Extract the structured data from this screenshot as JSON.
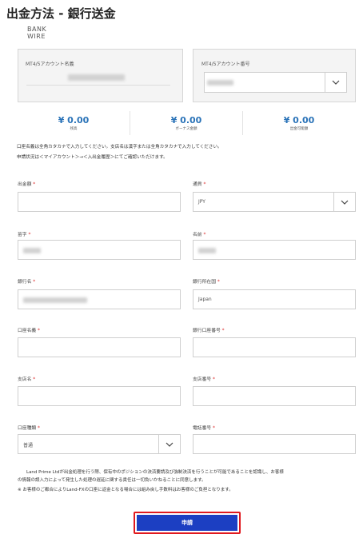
{
  "page_title": "出金方法 - 銀行送金",
  "logo": {
    "line1": "BANK",
    "line2": "WIRE"
  },
  "account": {
    "name_label": "MT4/5アカウント名義",
    "number_label": "MT4/5アカウント番号"
  },
  "balances": [
    {
      "value": "¥ 0.00",
      "label": "残高"
    },
    {
      "value": "¥ 0.00",
      "label": "ボーナス金額"
    },
    {
      "value": "¥ 0.00",
      "label": "出金可能額"
    }
  ],
  "notes": {
    "line1": "口座名義は全角カタカナで入力してください。支店名は漢字または全角カタカナで入力してください。",
    "line2": "申請状況は＜マイアカウント＞→＜入出金履歴＞にてご確認いただけます。"
  },
  "required_mark": "*",
  "form": {
    "amount_label": "出金額",
    "currency_label": "通貨",
    "currency_value": "JPY",
    "last_name_label": "苗字",
    "first_name_label": "名前",
    "bank_name_label": "銀行名",
    "bank_country_label": "銀行所在国",
    "bank_country_value": "Japan",
    "account_holder_label": "口座名義",
    "account_number_label": "銀行口座番号",
    "branch_name_label": "支店名",
    "branch_number_label": "支店番号",
    "account_type_label": "口座種類",
    "account_type_value": "普通",
    "phone_label": "電話番号"
  },
  "disclaimer": {
    "line1": "Land Prime Ltdが出金処理を行う際、保有中のポジションの決済要請及び強制決済を行うことが可能であることを認識し、お客様",
    "line2": "の情報の誤入力によって発生した処理の遅延に関する責任は一切負いかねることに同意します。",
    "line3": "※ お客様のご都合によりLand-FXの口座に返金となる場合には組み戻し手数料はお客様のご負担となります。"
  },
  "submit_label": "申請"
}
